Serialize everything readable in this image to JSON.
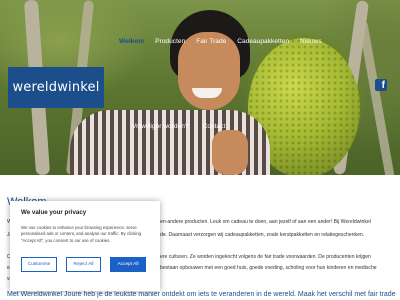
{
  "nav": {
    "items": [
      {
        "label": "Welkom",
        "active": true
      },
      {
        "label": "Producten"
      },
      {
        "label": "Fair Trade"
      },
      {
        "label": "Cadeaupakketten"
      },
      {
        "label": "Nieuws"
      }
    ]
  },
  "subnav": {
    "items": [
      {
        "label": "Vrijwilliger worden?"
      },
      {
        "label": "Contact"
      }
    ]
  },
  "logo": {
    "text": "wereldwinkel"
  },
  "social": {
    "facebook_glyph": "f"
  },
  "page": {
    "title": "Welkom",
    "lines": [
      "We",
      "en-andere producten. Leuk om cadeau te doen, aan jezelf of aan een ander! Bij Wereldwinkel",
      "Jou",
      "de. Daarnaast verzorgen wij cadeaupakketten, zoals kerstpakketten en relatiegeschenken.",
      "Om",
      "ere culturen. Ze worden ingekocht volgens de fair trade voorwaarden. De producenten krijgen",
      "een",
      "bestaan opbouwen met een goed huis, goede voeding, scholing voor hun kinderen en medische",
      "voo"
    ],
    "bottom_line": "Met Wereldwinkel Joure heb je de leukste manier ontdekt om iets te veranderen in de wereld. Maak het verschil met fair trade"
  },
  "cookie": {
    "title": "We value your privacy",
    "body": "We use cookies to enhance your browsing experience, serve personalised ads or content, and analyse our traffic. By clicking \"Accept All\", you consent to our use of cookies.",
    "customise_label": "Customise",
    "reject_label": "Reject All",
    "accept_label": "Accept All"
  },
  "colors": {
    "brand_blue": "#1c4e8c",
    "button_blue": "#1c61c6"
  }
}
